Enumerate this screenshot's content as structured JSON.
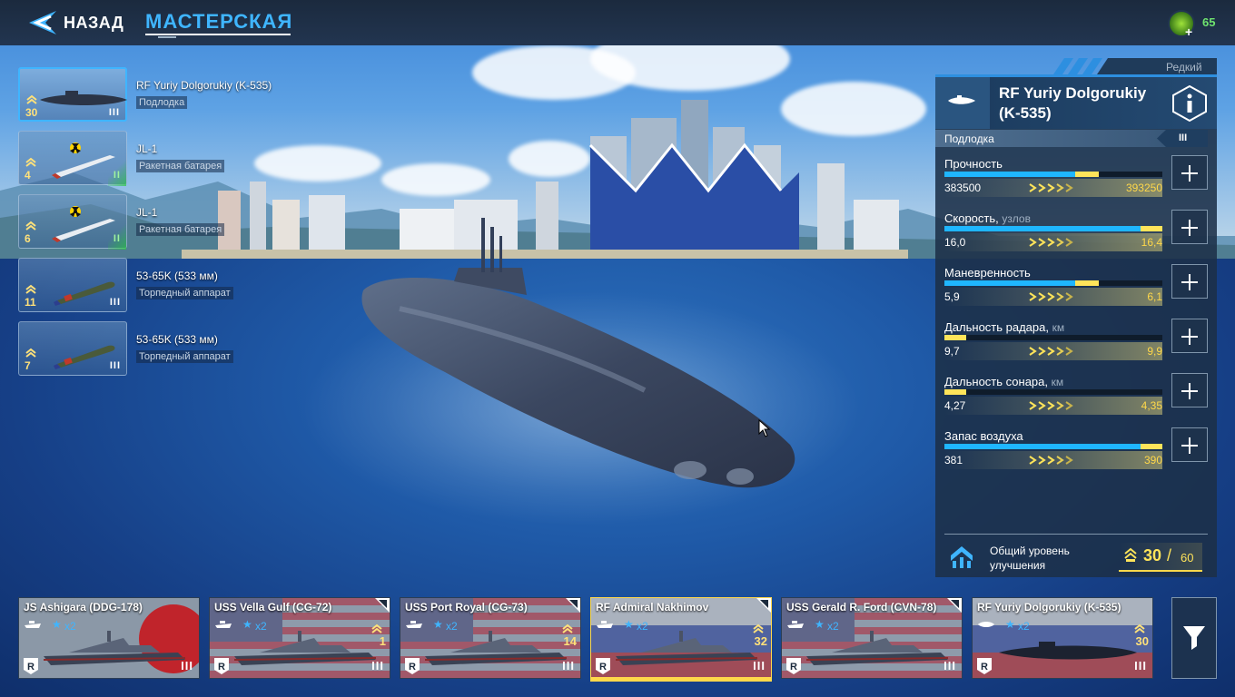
{
  "topbar": {
    "back_label": "НАЗАД",
    "title": "МАСТЕРСКАЯ",
    "currency_value": "65",
    "currency_plus": "+"
  },
  "equipment": [
    {
      "name": "RF Yuriy Dolgorukiy (K-535)",
      "type": "Подлодка",
      "level": "30",
      "tier": "III",
      "icon": "submarine-icon",
      "selected": true
    },
    {
      "name": "JL-1",
      "type": "Ракетная батарея",
      "level": "4",
      "tier": "II",
      "icon": "nuclear-missile-icon",
      "selected": false
    },
    {
      "name": "JL-1",
      "type": "Ракетная батарея",
      "level": "6",
      "tier": "II",
      "icon": "nuclear-missile-icon",
      "selected": false
    },
    {
      "name": "53-65K (533 мм)",
      "type": "Торпедный аппарат",
      "level": "11",
      "tier": "III",
      "icon": "torpedo-icon",
      "selected": false
    },
    {
      "name": "53-65K (533 мм)",
      "type": "Торпедный аппарат",
      "level": "7",
      "tier": "III",
      "icon": "torpedo-icon",
      "selected": false
    }
  ],
  "panel": {
    "rarity": "Редкий",
    "ship_name": "RF Yuriy Dolgorukiy (K-535)",
    "type_label": "Подлодка",
    "tier": "III",
    "stats": [
      {
        "label": "Прочность",
        "unit": "",
        "current": "383500",
        "max": "393250",
        "fill": 0.6,
        "upgrade": 0.71
      },
      {
        "label": "Скорость,",
        "unit": "узлов",
        "current": "16,0",
        "max": "16,4",
        "fill": 0.9,
        "upgrade": 1.0
      },
      {
        "label": "Маневренность",
        "unit": "",
        "current": "5,9",
        "max": "6,1",
        "fill": 0.6,
        "upgrade": 0.71
      },
      {
        "label": "Дальность радара,",
        "unit": "км",
        "current": "9,7",
        "max": "9,9",
        "fill": 0.0,
        "upgrade": 0.1
      },
      {
        "label": "Дальность сонара,",
        "unit": "км",
        "current": "4,27",
        "max": "4,35",
        "fill": 0.0,
        "upgrade": 0.1
      },
      {
        "label": "Запас воздуха",
        "unit": "",
        "current": "381",
        "max": "390",
        "fill": 0.9,
        "upgrade": 1.0
      }
    ],
    "upgrade_label": "Общий уровень улучшения",
    "upgrade_current": "30",
    "upgrade_slash": "/",
    "upgrade_max": "60"
  },
  "fleet": [
    {
      "name": "JS Ashigara (DDG-178)",
      "mult": "x2",
      "level": "",
      "tier": "III",
      "flag": "japan",
      "selected": false,
      "corner": false
    },
    {
      "name": "USS Vella Gulf (CG-72)",
      "mult": "x2",
      "level": "1",
      "tier": "III",
      "flag": "usa",
      "selected": false,
      "corner": true
    },
    {
      "name": "USS Port Royal (CG-73)",
      "mult": "x2",
      "level": "14",
      "tier": "III",
      "flag": "usa",
      "selected": false,
      "corner": true
    },
    {
      "name": "RF Admiral Nakhimov",
      "mult": "x2",
      "level": "32",
      "tier": "III",
      "flag": "russia",
      "selected": true,
      "corner": true
    },
    {
      "name": "USS Gerald R. Ford (CVN-78)",
      "mult": "x2",
      "level": "",
      "tier": "III",
      "flag": "usa",
      "selected": false,
      "corner": true
    },
    {
      "name": "RF Yuriy Dolgorukiy (K-535)",
      "mult": "x2",
      "level": "30",
      "tier": "III",
      "flag": "russia",
      "selected": false,
      "corner": false
    }
  ],
  "colors": {
    "accent": "#3fb5ff",
    "upgrade": "#ffe45a",
    "currency": "#6fe36f"
  }
}
